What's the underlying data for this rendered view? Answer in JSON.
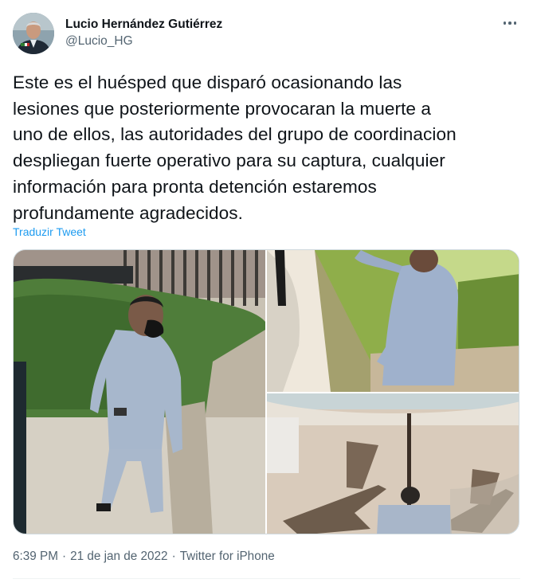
{
  "author": {
    "display_name": "Lucio Hernández Gutiérrez",
    "handle": "@Lucio_HG",
    "avatar_icon": "user-avatar"
  },
  "more_icon": "more-horizontal-icon",
  "tweet": {
    "text": "Este es el huésped que disparó ocasionando las\nlesiones que posteriormente provocaran la muerte a\nuno de ellos, las autoridades del grupo de coordinacion\ndespliegan fuerte operativo para su captura, cualquier\ninformación para pronta detención estaremos\nprofundamente agradecidos.",
    "translate_label": "Traduzir Tweet"
  },
  "media": {
    "photos": [
      "man-walking-cctv",
      "man-pointing-cctv",
      "poolside-lounge-cctv"
    ]
  },
  "meta": {
    "time": "6:39 PM",
    "date": "21 de jan de 2022",
    "source": "Twitter for iPhone",
    "separator": "·"
  },
  "colors": {
    "link": "#1d9bf0",
    "text": "#0f1419",
    "secondary": "#536471"
  }
}
